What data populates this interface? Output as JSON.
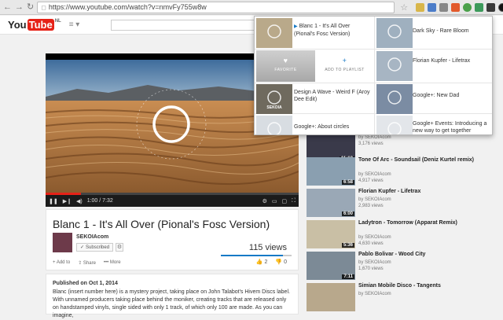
{
  "browser": {
    "url": "https://www.youtube.com/watch?v=nmvFy755w8w"
  },
  "youtube": {
    "logo_you": "You",
    "logo_tube": "Tube",
    "logo_country": "NL"
  },
  "player": {
    "time": "1:00 / 7:32",
    "progress_fraction": 0.14
  },
  "video": {
    "title": "Blanc 1 - It's All Over (Pional's Fosc Version)",
    "channel": "SEKOIAcom",
    "subscribed_label": "Subscribed",
    "views": "115 views",
    "likes": "2",
    "dislikes": "0",
    "like_ratio": 0.88,
    "actions": [
      "Add to",
      "Share",
      "More"
    ]
  },
  "description": {
    "published": "Published on Oct 1, 2014",
    "text": "Blanc (insert number here) is a mystery project, taking place on John Talabot's Hivem Discs label. With unnamed producers taking place behind the moniker, creating tracks that are released only on handstamped vinyls, single sided with only 1 track, of which only 100 are made. As you can imagine,"
  },
  "related": [
    {
      "title": "",
      "channel": "by SEKOIAcom",
      "views": "3,176 views",
      "duration": "11:18",
      "thumb_color": "#3a3a4a"
    },
    {
      "title": "Tone Of Arc - Soundsail (Deniz Kurtel remix)",
      "channel": "by SEKOIAcom",
      "views": "4,917 views",
      "duration": "6:58",
      "thumb_color": "#8a9fb0"
    },
    {
      "title": "Florian Kupfer - Lifetrax",
      "channel": "by SEKOIAcom",
      "views": "2,983 views",
      "duration": "6:00",
      "thumb_color": "#9aa8b6"
    },
    {
      "title": "Ladytron - Tomorrow (Apparat Remix)",
      "channel": "by SEKOIAcom",
      "views": "4,630 views",
      "duration": "5:36",
      "thumb_color": "#c9bfa5"
    },
    {
      "title": "Pablo Bolivar - Wood City",
      "channel": "by SEKOIAcom",
      "views": "1,670 views",
      "duration": "7:11",
      "thumb_color": "#7c8a96"
    },
    {
      "title": "Simian Mobile Disco - Tangents",
      "channel": "by SEKOIAcom",
      "views": "",
      "duration": "",
      "thumb_color": "#b8a88c"
    }
  ],
  "popup": {
    "items": [
      {
        "label": "Blanc 1 - It's All Over (Pional's Fosc Version)",
        "playing": true,
        "thumb_color": "#b9a98a"
      },
      {
        "label": "Dark Sky - Rare Bloom",
        "playing": false,
        "thumb_color": "#9fb0bf"
      },
      {
        "label": "Florian Kupfer - Lifetrax",
        "playing": false,
        "thumb_color": "#a7b5c3"
      },
      {
        "label": "Design A Wave - Weird F (Aroy Dee Edit)",
        "playing": false,
        "thumb_color": "#6f6a5e"
      },
      {
        "label": "Google+: New Dad",
        "playing": false,
        "thumb_color": "#7b8ca3"
      },
      {
        "label": "Google+: About circles",
        "playing": false,
        "thumb_color": "#d8dde2"
      },
      {
        "label": "Google+ Events: Introducing a new way to get together",
        "playing": false,
        "thumb_color": "#e3e6ea"
      }
    ],
    "favorite_label": "FAVORITE",
    "add_playlist_label": "ADD TO PLAYLIST",
    "sekoia_text": "SEKOIA"
  },
  "colors": {
    "youtube_red": "#e62117",
    "link_blue": "#167ac6",
    "sand_light": "#d9a56a",
    "sand_dark": "#7a4a23"
  }
}
